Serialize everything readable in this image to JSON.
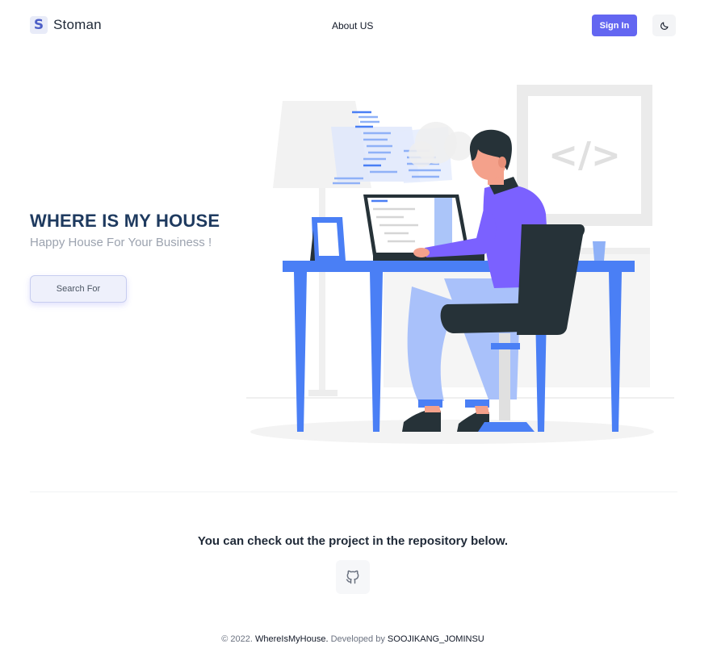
{
  "header": {
    "logo_letter": "S",
    "brand_name": "Stoman",
    "nav_about": "About US",
    "signin_label": "Sign In",
    "theme_icon": "moon-icon"
  },
  "hero": {
    "title": "WHERE IS MY HOUSE",
    "subtitle": "Happy House For Your Business !",
    "search_button": "Search For",
    "illustration_code_glyph": "</>"
  },
  "repo": {
    "text": "You can check out the project in the repository below.",
    "icon": "github-icon"
  },
  "footer": {
    "copyright": "© 2022.",
    "site": "WhereIsMyHouse.",
    "developed_by": "Developed by",
    "authors": "SOOJIKANG_JOMINSU"
  },
  "colors": {
    "accent": "#6366f1",
    "title": "#1e3a5f",
    "desk_blue": "#4a7ff5",
    "shirt_purple": "#7b61ff",
    "chair_dark": "#263238"
  }
}
